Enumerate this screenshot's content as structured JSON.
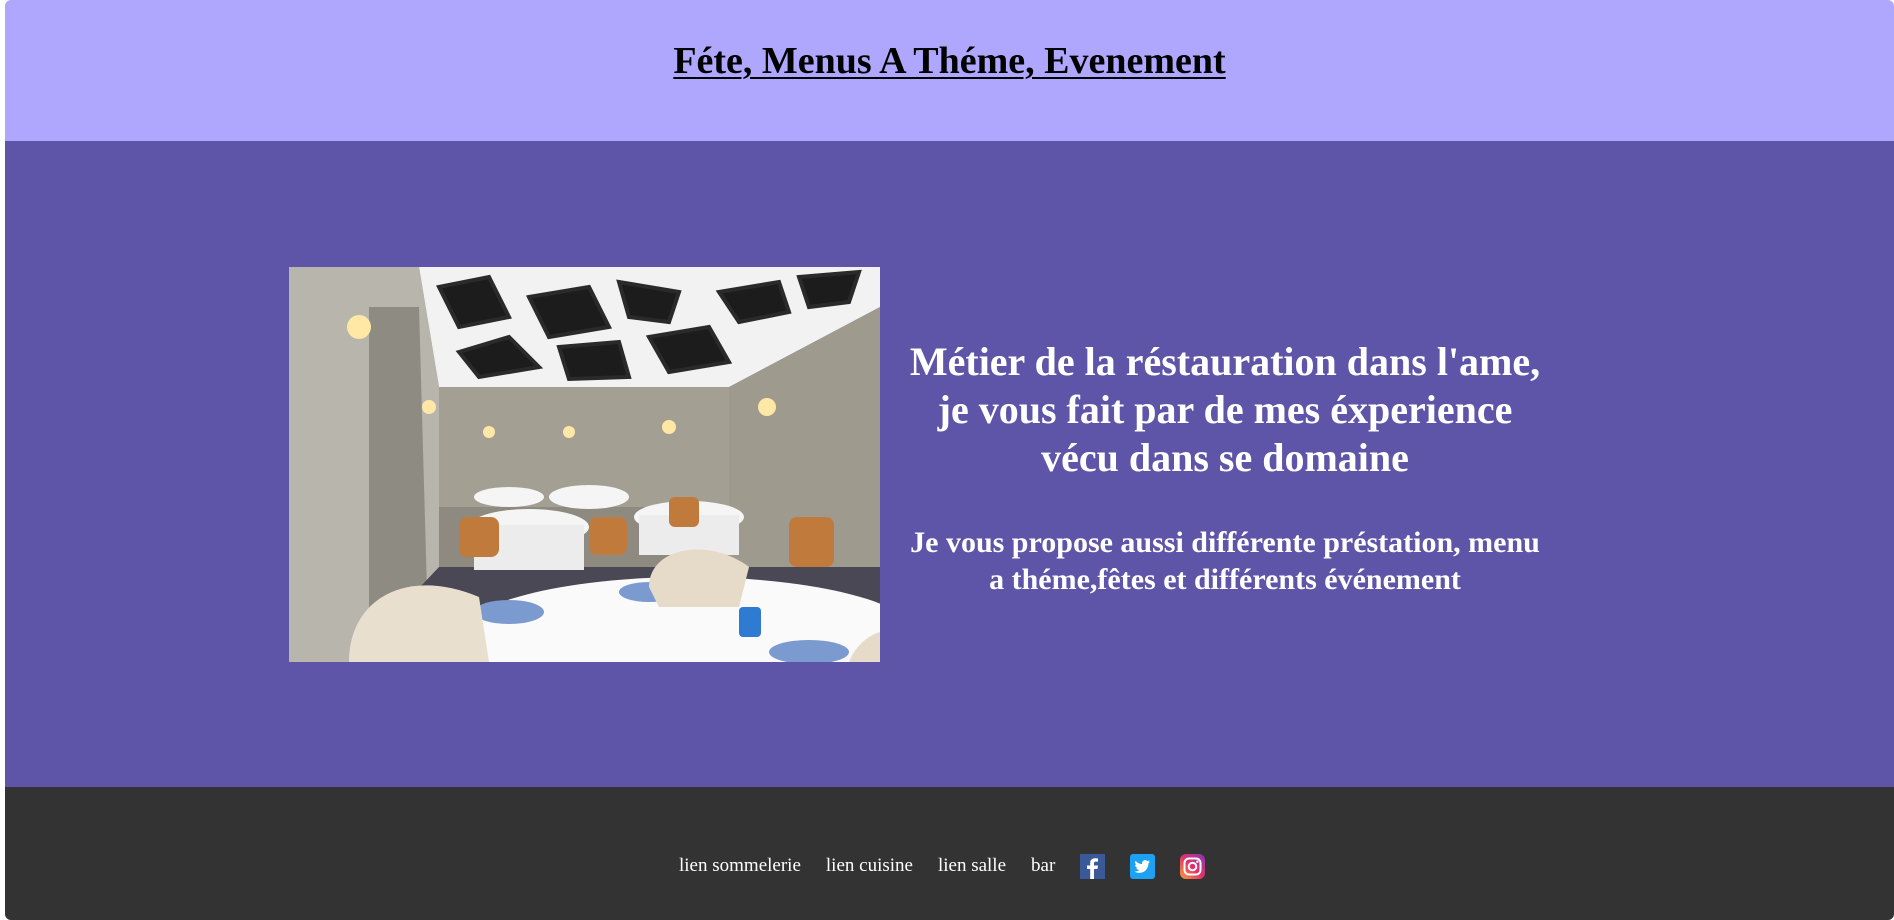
{
  "header": {
    "title": "Féte, Menus A Théme, Evenement"
  },
  "main": {
    "photo": {
      "alt": "restaurant dining room"
    },
    "headline": "Métier de la réstauration dans l'ame, je vous fait par de mes éxperience vécu dans se domaine",
    "subheadline": "Je vous propose aussi différente préstation, menu a théme,fêtes et différents événement"
  },
  "footer": {
    "links": [
      {
        "label": "lien sommelerie"
      },
      {
        "label": "lien cuisine"
      },
      {
        "label": "lien salle"
      },
      {
        "label": "bar"
      }
    ],
    "social": [
      {
        "icon": "facebook-icon",
        "color": "#3b5998"
      },
      {
        "icon": "twitter-icon",
        "color": "#1da1f2"
      },
      {
        "icon": "instagram-icon",
        "color": "#e1306c"
      }
    ]
  },
  "colors": {
    "header_bg": "#afa7fd",
    "main_bg": "#5e55a9",
    "footer_bg": "#333333"
  }
}
